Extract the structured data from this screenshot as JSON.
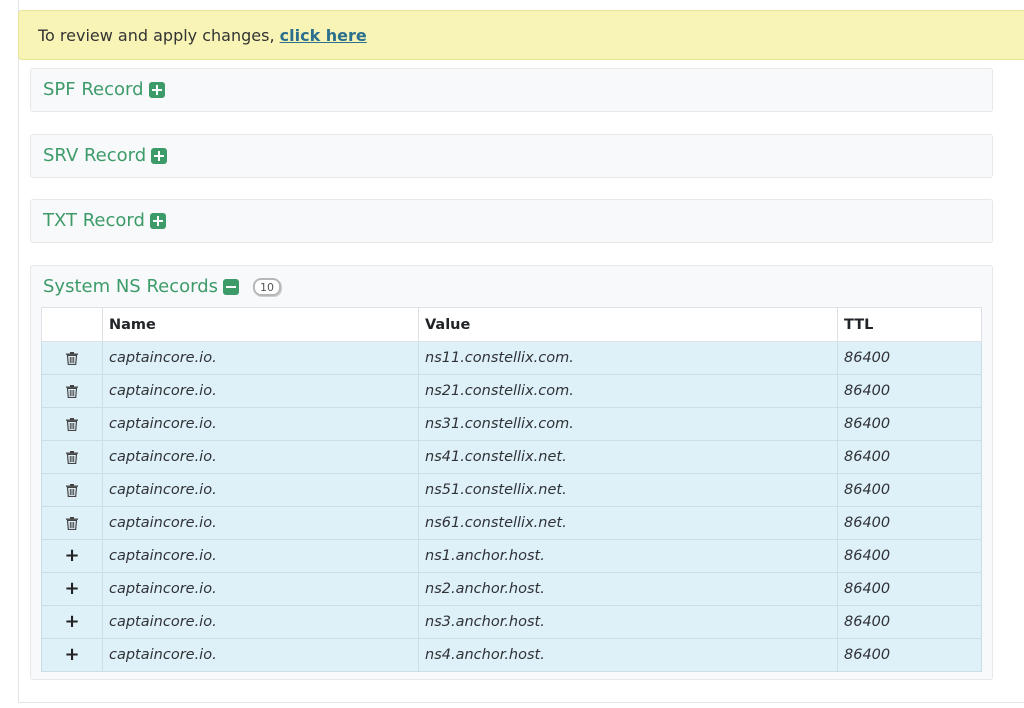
{
  "notice": {
    "text": "To review and apply changes, ",
    "link_label": "click here"
  },
  "sections": {
    "spf": {
      "title": "SPF Record",
      "icon": "plus-square-icon"
    },
    "srv": {
      "title": "SRV Record",
      "icon": "plus-square-icon"
    },
    "txt": {
      "title": "TXT Record",
      "icon": "plus-square-icon"
    }
  },
  "system_ns": {
    "title": "System NS Records",
    "icon": "minus-square-icon",
    "count": "10",
    "columns": {
      "name": "Name",
      "value": "Value",
      "ttl": "TTL"
    },
    "rows": [
      {
        "action": "trash-icon",
        "name": "captaincore.io.",
        "value": "ns11.constellix.com.",
        "ttl": "86400"
      },
      {
        "action": "trash-icon",
        "name": "captaincore.io.",
        "value": "ns21.constellix.com.",
        "ttl": "86400"
      },
      {
        "action": "trash-icon",
        "name": "captaincore.io.",
        "value": "ns31.constellix.com.",
        "ttl": "86400"
      },
      {
        "action": "trash-icon",
        "name": "captaincore.io.",
        "value": "ns41.constellix.net.",
        "ttl": "86400"
      },
      {
        "action": "trash-icon",
        "name": "captaincore.io.",
        "value": "ns51.constellix.net.",
        "ttl": "86400"
      },
      {
        "action": "trash-icon",
        "name": "captaincore.io.",
        "value": "ns61.constellix.net.",
        "ttl": "86400"
      },
      {
        "action": "plus-icon",
        "name": "captaincore.io.",
        "value": "ns1.anchor.host.",
        "ttl": "86400"
      },
      {
        "action": "plus-icon",
        "name": "captaincore.io.",
        "value": "ns2.anchor.host.",
        "ttl": "86400"
      },
      {
        "action": "plus-icon",
        "name": "captaincore.io.",
        "value": "ns3.anchor.host.",
        "ttl": "86400"
      },
      {
        "action": "plus-icon",
        "name": "captaincore.io.",
        "value": "ns4.anchor.host.",
        "ttl": "86400"
      }
    ]
  },
  "colors": {
    "accent_green": "#3d9b6a",
    "notice_bg": "#f7f4b6",
    "row_bg": "#dff1f8",
    "link": "#2b6f8e"
  }
}
